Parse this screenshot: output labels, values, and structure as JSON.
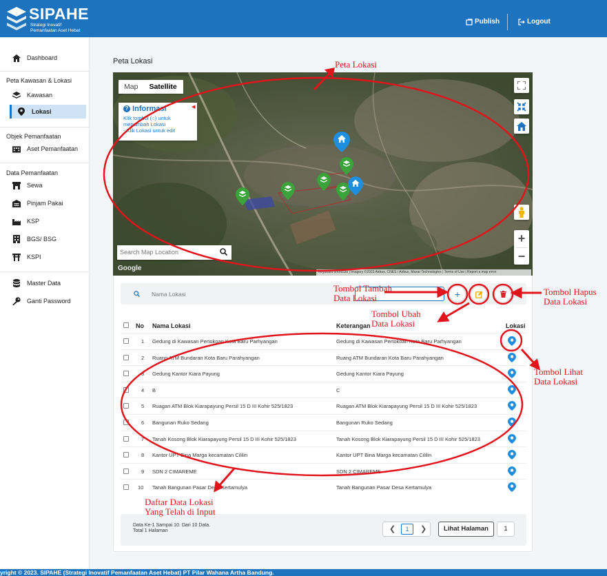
{
  "header": {
    "brand": "SIPAHE",
    "brand_sub1": "Strategi Inovatif",
    "brand_sub2": "Pemanfaatan Aset Hebat",
    "publish_label": "Publish",
    "logout_label": "Logout"
  },
  "sidebar": {
    "dashboard": "Dashboard",
    "section_peta": "Peta Kawasan & Lokasi",
    "kawasan": "Kawasan",
    "lokasi": "Lokasi",
    "section_objek": "Objek Pemanfaatan",
    "aset": "Aset Pemanfaatan",
    "section_data": "Data Pemanfaatan",
    "sewa": "Sewa",
    "pinjam": "Pinjam Pakai",
    "ksp": "KSP",
    "bgs": "BGS/ BSG",
    "kspi": "KSPI",
    "master": "Master Data",
    "password": "Ganti Password"
  },
  "page": {
    "title": "Peta Lokasi"
  },
  "map": {
    "tab_map": "Map",
    "tab_satellite": "Satellite",
    "info_title": "Informasi",
    "info_line1": "Klik tombol (⌂) untuk",
    "info_line2": "menambah Lokasi",
    "info_line3": "- Klik Lokasi untuk edit",
    "search_placeholder": "Search Map Location",
    "google": "Google",
    "attribution": "Keyboard shortcuts | Imagery ©2023 Airbus, CNES / Airbus, Maxar Technologies | Terms of Use | Report a map error"
  },
  "toolbar": {
    "search_placeholder": "Nama Lokasi"
  },
  "table": {
    "col_no": "No",
    "col_nama": "Nama Lokasi",
    "col_ket": "Keterangan",
    "col_lokasi": "Lokasi",
    "rows": [
      {
        "no": "1",
        "nama": "Gedung di Kawasan Pertokoan Kota Baru Parhyangan",
        "ket": "Gedung di Kawasan Pertokoan Kota Baru Parhyangan"
      },
      {
        "no": "2",
        "nama": "Ruang ATM Bundaran Kota Baru Parahyangan",
        "ket": "Ruang ATM Bundaran Kota Baru Parahyangan"
      },
      {
        "no": "3",
        "nama": "Gedung Kantor Kiara Payung",
        "ket": "Gedung Kantor Kiara Payung"
      },
      {
        "no": "4",
        "nama": "B",
        "ket": "C"
      },
      {
        "no": "5",
        "nama": "Ruagan ATM Blok Kiarapayung Persil 15 D III Kohir 525/1823",
        "ket": "Ruagan ATM Blok Kiarapayung Persil 15 D III Kohir 525/1823"
      },
      {
        "no": "6",
        "nama": "Bangunan Ruko Sedang",
        "ket": "Bangunan Ruko Sedang"
      },
      {
        "no": "7",
        "nama": "Tanah Kosong Blok Kiarapayung Persil 15 D III Kohir 525/1823",
        "ket": "Tanah Kosong Blok Kiarapayung Persil 15 D III Kohir 525/1823"
      },
      {
        "no": "8",
        "nama": "Kantor UPT Bina Marga kecamatan Cililin",
        "ket": "Kantor UPT Bina Marga kecamatan Cililin"
      },
      {
        "no": "9",
        "nama": "SDN 2 CIMAREME",
        "ket": "SDN 2 CIMAREME"
      },
      {
        "no": "10",
        "nama": "Tanah Bangunan Pasar Desa Kertamulya",
        "ket": "Tanah Bangunan Pasar Desa Kertamulya"
      }
    ]
  },
  "pagination": {
    "info1": "Data Ke-1 Sampai 10. Dari 10 Data.",
    "info2": "Total 1 Halaman",
    "current": "1",
    "lihat_label": "Lihat Halaman",
    "page_value": "1"
  },
  "footer": {
    "text": "yright © 2023. SIPAHE (Strategi Inovatif Pemanfaatan Aset Hebat) PT Pilar Wahana Artha Bandung."
  },
  "annotations": {
    "peta": "Peta Lokasi",
    "tambah1": "Tombol Tambah",
    "tambah2": "Data Lokasi",
    "ubah1": "Tombol Ubah",
    "ubah2": "Data Lokasi",
    "hapus1": "Tombol Hapus",
    "hapus2": "Data Lokasi",
    "lihat1": "Tombol Lihat",
    "lihat2": "Data Lokasi",
    "daftar1": "Daftar Data Lokasi",
    "daftar2": "Yang Telah di Input"
  },
  "colors": {
    "primary": "#1e73be",
    "annotation": "#e1141c"
  }
}
